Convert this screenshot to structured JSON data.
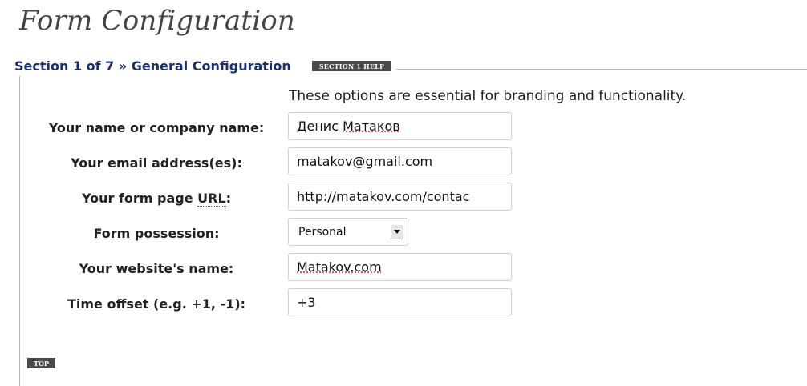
{
  "page": {
    "title": "Form Configuration"
  },
  "section": {
    "legend": "Section 1 of 7 » General Configuration",
    "help_label": "SECTION 1 HELP",
    "intro": "These options are essential for branding and functionality."
  },
  "fields": {
    "name": {
      "label": "Your name or company name:",
      "value_first": "Денис",
      "value_second": "Матаков"
    },
    "email": {
      "label_prefix": "Your email address(",
      "label_abbr": "es",
      "label_suffix": "):",
      "value": "matakov@gmail.com"
    },
    "url": {
      "label_prefix": "Your form page ",
      "label_abbr": "URL",
      "label_suffix": ":",
      "value": "http://matakov.com/contac"
    },
    "possession": {
      "label": "Form possession:",
      "selected": "Personal"
    },
    "website": {
      "label": "Your website's name:",
      "value": "Matakov.com"
    },
    "offset": {
      "label": "Time offset (e.g. +1, -1):",
      "value": "+3"
    }
  },
  "footer": {
    "top_label": "TOP"
  }
}
